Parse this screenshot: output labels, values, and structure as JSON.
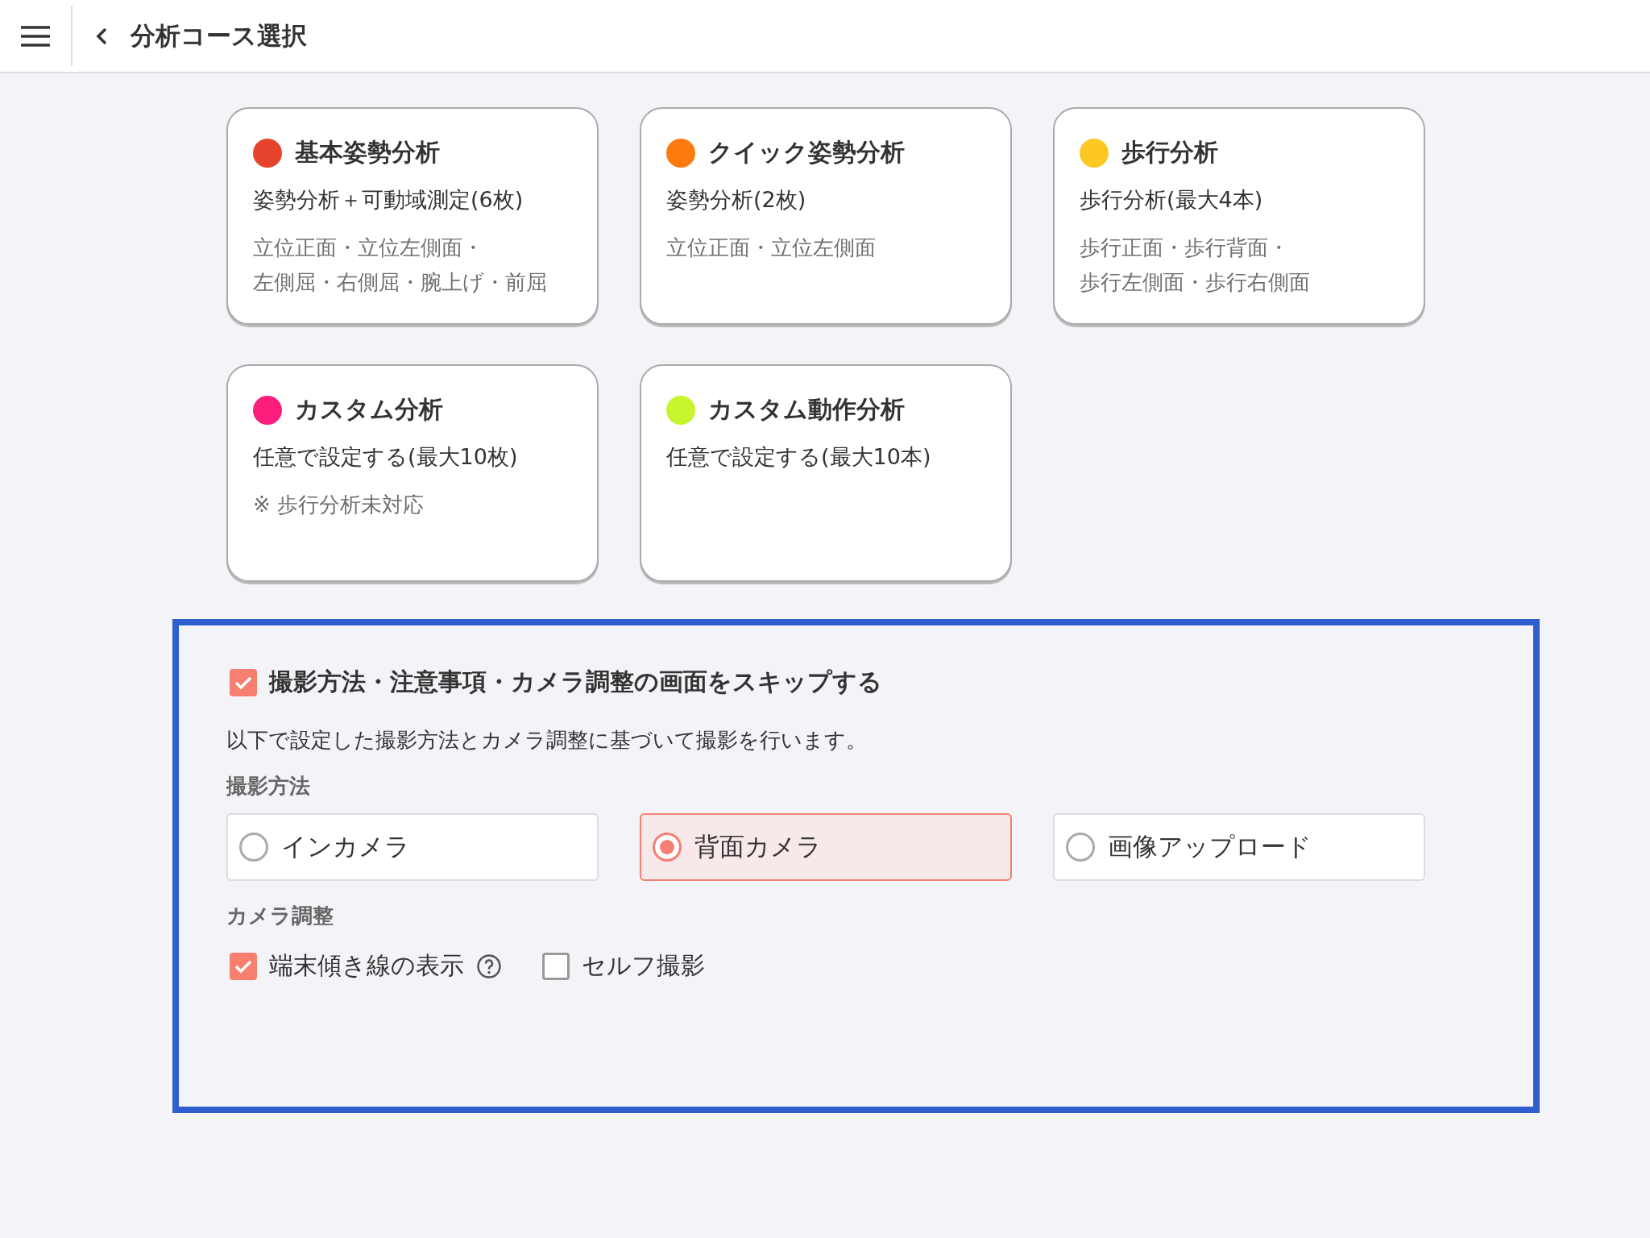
{
  "header": {
    "title": "分析コース選択"
  },
  "courses": [
    {
      "title": "基本姿勢分析",
      "color": "#e5432b",
      "subtitle": "姿勢分析＋可動域測定(6枚)",
      "details": [
        "立位正面・立位左側面・",
        "左側屈・右側屈・腕上げ・前屈"
      ]
    },
    {
      "title": "クイック姿勢分析",
      "color": "#fd7a0c",
      "subtitle": "姿勢分析(2枚)",
      "details": [
        "立位正面・立位左側面"
      ]
    },
    {
      "title": "歩行分析",
      "color": "#fdc823",
      "subtitle": "歩行分析(最大4本)",
      "details": [
        "歩行正面・歩行背面・",
        "歩行左側面・歩行右側面"
      ]
    },
    {
      "title": "カスタム分析",
      "color": "#fb1d7c",
      "subtitle": "任意で設定する(最大10枚)",
      "details": [
        "※ 歩行分析未対応"
      ]
    },
    {
      "title": "カスタム動作分析",
      "color": "#c6f52c",
      "subtitle": "任意で設定する(最大10本)"
    }
  ],
  "settings": {
    "skip": {
      "label": "撮影方法・注意事項・カメラ調整の画面をスキップする",
      "checked": true
    },
    "description": "以下で設定した撮影方法とカメラ調整に基づいて撮影を行います。",
    "method_label": "撮影方法",
    "methods": [
      {
        "label": "インカメラ",
        "selected": false
      },
      {
        "label": "背面カメラ",
        "selected": true
      },
      {
        "label": "画像アップロード",
        "selected": false
      }
    ],
    "camera_label": "カメラ調整",
    "camera_options": [
      {
        "label": "端末傾き線の表示",
        "checked": true,
        "help": true
      },
      {
        "label": "セルフ撮影",
        "checked": false,
        "help": false
      }
    ]
  }
}
